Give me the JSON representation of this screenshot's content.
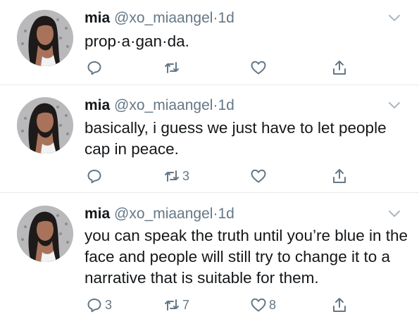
{
  "colors": {
    "text": "#14171a",
    "muted": "#657786",
    "divider": "#e6ecf0",
    "background": "#ffffff"
  },
  "tweets": [
    {
      "name": "mia",
      "handle": "@xo_miaangel",
      "separator": "·",
      "time": "1d",
      "text": "prop·a·gan·da.",
      "replies": "",
      "retweets": "",
      "likes": "",
      "icons": [
        "avatar-photo",
        "chevron-down-icon",
        "reply-icon",
        "retweet-icon",
        "like-icon",
        "share-icon"
      ]
    },
    {
      "name": "mia",
      "handle": "@xo_miaangel",
      "separator": "·",
      "time": "1d",
      "text": "basically, i guess we just have to let people cap in peace.",
      "replies": "",
      "retweets": "3",
      "likes": "",
      "icons": [
        "avatar-photo",
        "chevron-down-icon",
        "reply-icon",
        "retweet-icon",
        "like-icon",
        "share-icon"
      ]
    },
    {
      "name": "mia",
      "handle": "@xo_miaangel",
      "separator": "·",
      "time": "1d",
      "text": "you can speak the truth until you’re blue in the face and people will still try to change it to a narrative that is suitable for them.",
      "replies": "3",
      "retweets": "7",
      "likes": "8",
      "icons": [
        "avatar-photo",
        "chevron-down-icon",
        "reply-icon",
        "retweet-icon",
        "like-icon",
        "share-icon"
      ]
    }
  ]
}
